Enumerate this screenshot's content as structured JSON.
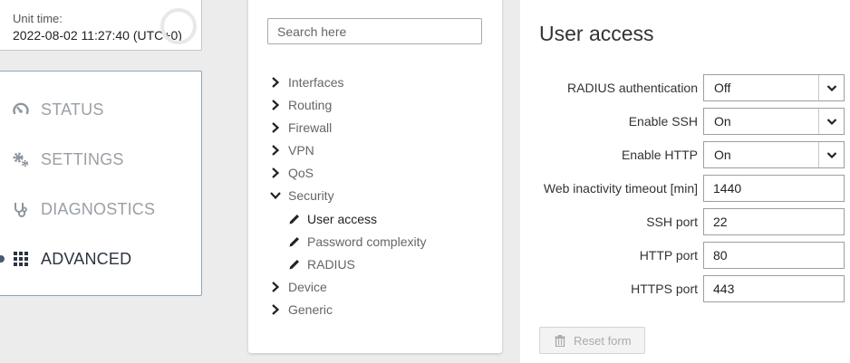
{
  "unit_time": {
    "label": "Unit time:",
    "value": "2022-08-02 11:27:40 (UTC+0)"
  },
  "nav": {
    "items": [
      {
        "label": "STATUS",
        "icon": "gauge-icon"
      },
      {
        "label": "SETTINGS",
        "icon": "gears-icon"
      },
      {
        "label": "DIAGNOSTICS",
        "icon": "stethoscope-icon"
      },
      {
        "label": "ADVANCED",
        "icon": "grid-icon"
      }
    ],
    "active": "ADVANCED"
  },
  "tree": {
    "search_placeholder": "Search here",
    "items": [
      {
        "label": "Interfaces",
        "expanded": false
      },
      {
        "label": "Routing",
        "expanded": false
      },
      {
        "label": "Firewall",
        "expanded": false
      },
      {
        "label": "VPN",
        "expanded": false
      },
      {
        "label": "QoS",
        "expanded": false
      },
      {
        "label": "Security",
        "expanded": true
      },
      {
        "label": "Device",
        "expanded": false
      },
      {
        "label": "Generic",
        "expanded": false
      }
    ],
    "security_children": [
      {
        "label": "User access",
        "selected": true
      },
      {
        "label": "Password complexity",
        "selected": false
      },
      {
        "label": "RADIUS",
        "selected": false
      }
    ]
  },
  "form": {
    "title": "User access",
    "fields": [
      {
        "label": "RADIUS authentication",
        "type": "select",
        "value": "Off"
      },
      {
        "label": "Enable SSH",
        "type": "select",
        "value": "On"
      },
      {
        "label": "Enable HTTP",
        "type": "select",
        "value": "On"
      },
      {
        "label": "Web inactivity timeout [min]",
        "type": "text",
        "value": "1440"
      },
      {
        "label": "SSH port",
        "type": "text",
        "value": "22"
      },
      {
        "label": "HTTP port",
        "type": "text",
        "value": "80"
      },
      {
        "label": "HTTPS port",
        "type": "text",
        "value": "443"
      }
    ],
    "reset_label": "Reset form"
  },
  "colors": {
    "nav_border": "#8fa3b8",
    "nav_inactive": "#9aa0a6",
    "nav_active": "#2c3440",
    "background": "#ececec"
  }
}
